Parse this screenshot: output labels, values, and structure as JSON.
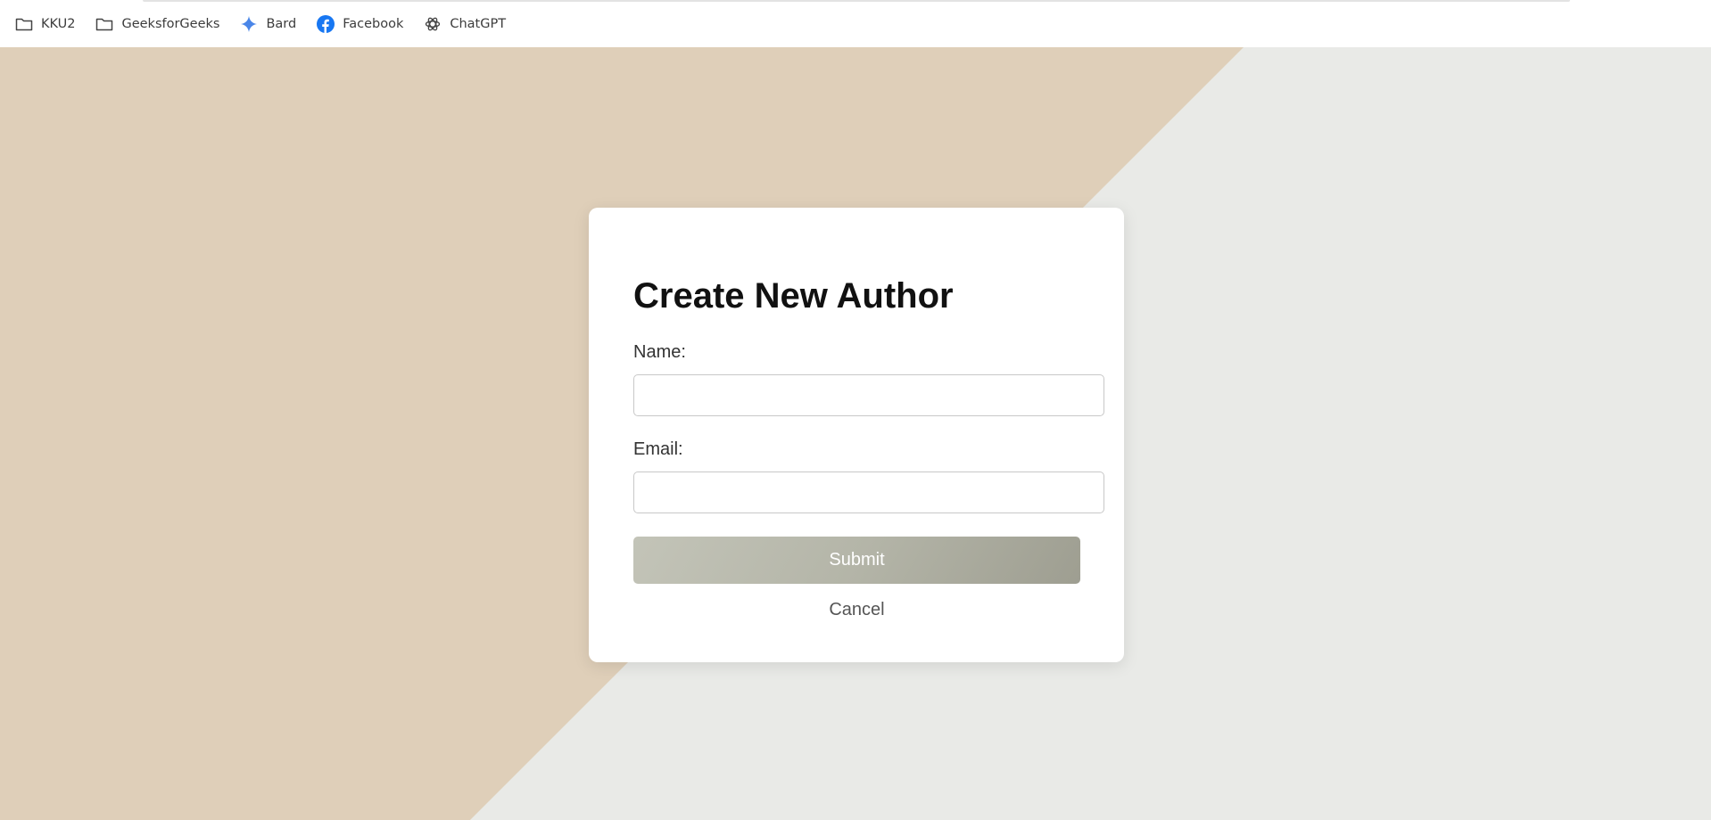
{
  "bookmarks": {
    "items": [
      {
        "label": "KKU2",
        "icon": "folder-icon"
      },
      {
        "label": "GeeksforGeeks",
        "icon": "folder-icon"
      },
      {
        "label": "Bard",
        "icon": "bard-sparkle-icon"
      },
      {
        "label": "Facebook",
        "icon": "facebook-icon"
      },
      {
        "label": "ChatGPT",
        "icon": "chatgpt-icon"
      }
    ]
  },
  "colors": {
    "background_left": "#dfcfb9",
    "background_right": "#e9eae7",
    "submit_gradient_start": "#c3c4b8",
    "submit_gradient_end": "#9e9e91",
    "bard_blue": "#4a86e8",
    "facebook_blue": "#1877f2"
  },
  "form": {
    "title": "Create New Author",
    "name_label": "Name:",
    "name_value": "",
    "email_label": "Email:",
    "email_value": "",
    "submit_label": "Submit",
    "cancel_label": "Cancel"
  }
}
